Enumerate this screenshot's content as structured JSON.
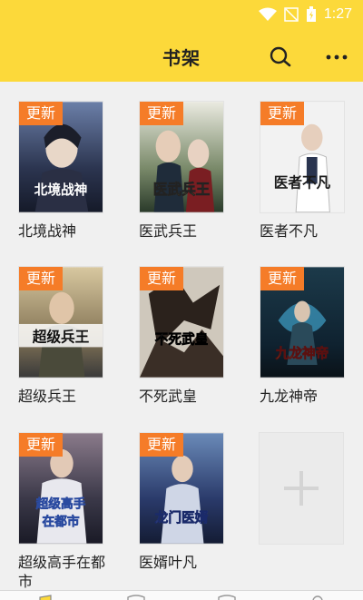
{
  "status": {
    "time": "1:27"
  },
  "header": {
    "title": "书架"
  },
  "badge_label": "更新",
  "books": [
    {
      "title": "北境战神"
    },
    {
      "title": "医武兵王"
    },
    {
      "title": "医者不凡"
    },
    {
      "title": "超级兵王"
    },
    {
      "title": "不死武皇"
    },
    {
      "title": "九龙神帝"
    },
    {
      "title": "超级高手在都市"
    },
    {
      "title": "医婿叶凡"
    }
  ],
  "covers": [
    {
      "text": "北境战神"
    },
    {
      "text": "医武兵王"
    },
    {
      "text": "医者不凡"
    },
    {
      "text": "超级兵王"
    },
    {
      "text": "不死武皇"
    },
    {
      "text": "九龙神帝"
    },
    {
      "text": "超级高手在都市"
    },
    {
      "text": "龙门医婿"
    }
  ],
  "colors": {
    "accent": "#fcd93a",
    "badge": "#f57c28"
  },
  "icons": {
    "search": "search-icon",
    "more": "more-icon",
    "add": "plus-icon"
  }
}
